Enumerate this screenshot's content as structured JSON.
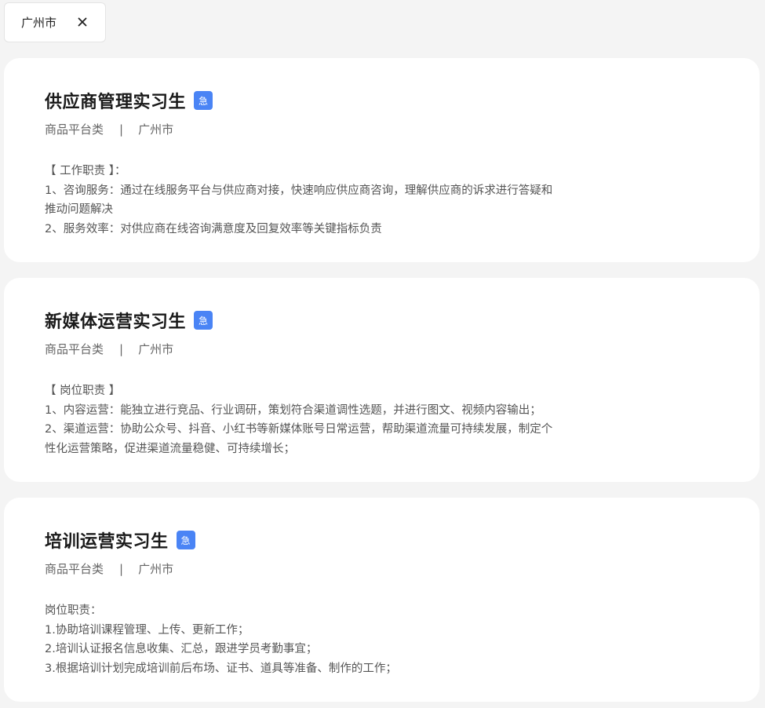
{
  "filter": {
    "label": "广州市",
    "close_symbol": "×"
  },
  "jobs": [
    {
      "title": "供应商管理实习生",
      "badge": "急",
      "category": "商品平台类",
      "separator": "|",
      "city": "广州市",
      "desc": [
        "【 工作职责 】：",
        "1、咨询服务：通过在线服务平台与供应商对接，快速响应供应商咨询，理解供应商的诉求进行答疑和",
        "推动问题解决",
        "2、服务效率：对供应商在线咨询满意度及回复效率等关键指标负责"
      ]
    },
    {
      "title": "新媒体运营实习生",
      "badge": "急",
      "category": "商品平台类",
      "separator": "|",
      "city": "广州市",
      "desc": [
        "【 岗位职责 】",
        "1、内容运营：能独立进行竞品、行业调研，策划符合渠道调性选题，并进行图文、视频内容输出；",
        "2、渠道运营：协助公众号、抖音、小红书等新媒体账号日常运营，帮助渠道流量可持续发展，制定个",
        "性化运营策略，促进渠道流量稳健、可持续增长；"
      ]
    },
    {
      "title": "培训运营实习生",
      "badge": "急",
      "category": "商品平台类",
      "separator": "|",
      "city": "广州市",
      "desc": [
        "岗位职责：",
        "1.协助培训课程管理、上传、更新工作；",
        "2.培训认证报名信息收集、汇总，跟进学员考勤事宜；",
        "3.根据培训计划完成培训前后布场、证书、道具等准备、制作的工作；"
      ]
    }
  ]
}
